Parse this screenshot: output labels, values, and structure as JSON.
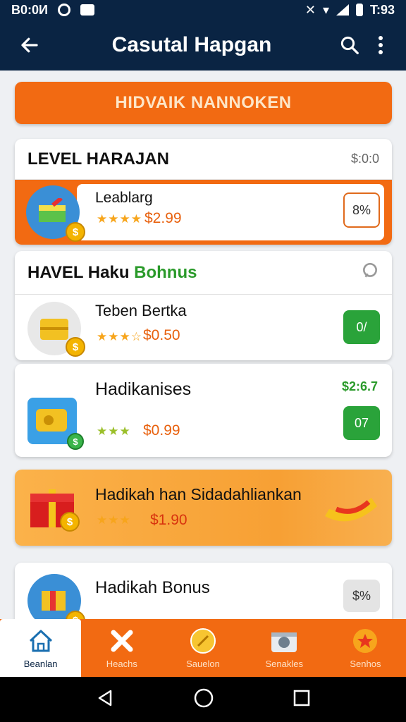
{
  "status": {
    "left_text": "B0:0И",
    "right_text": "T:93"
  },
  "appbar": {
    "title": "Casutal Hapgan"
  },
  "banner": {
    "label": "HIDVAIK NANNOKEN"
  },
  "level_section": {
    "title": "LEVEL HARAJAN",
    "right": "$:0:0",
    "item": {
      "name": "Leablarg",
      "stars": "★★★★",
      "price": "$2.99",
      "button": "8%"
    }
  },
  "bonus_section": {
    "title_prefix": "HAVEL Haku",
    "title_accent": "Bohnus",
    "items": [
      {
        "name": "Teben Bertka",
        "stars": "★★★☆",
        "price": "$0.50",
        "button": "0/"
      },
      {
        "name": "Hadikanises",
        "stars": "★★★",
        "price": "$0.99",
        "top_right": "$2:6.7",
        "button": "07"
      }
    ]
  },
  "promo": {
    "name": "Hadikah han Sidadahliankan",
    "stars": "★★★",
    "price": "$1.90"
  },
  "last_item": {
    "name": "Hadikah Bonus",
    "button": "$%"
  },
  "bottom_nav": [
    {
      "label": "Beanlan",
      "icon": "home-icon"
    },
    {
      "label": "Heachs",
      "icon": "tools-icon"
    },
    {
      "label": "Sauelon",
      "icon": "coin-icon"
    },
    {
      "label": "Senakles",
      "icon": "camera-icon"
    },
    {
      "label": "Senhos",
      "icon": "star-icon"
    }
  ],
  "colors": {
    "primary": "#0a2443",
    "accent": "#f26a12",
    "green": "#2aa33a"
  }
}
